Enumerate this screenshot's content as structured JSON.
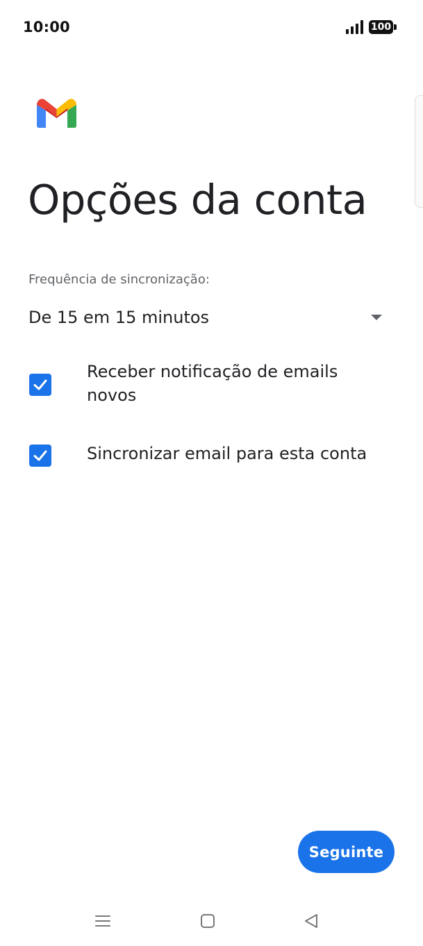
{
  "status_bar": {
    "time": "10:00",
    "signal_icon": "signal-strength-icon",
    "battery_level": "100",
    "battery_icon": "battery-icon"
  },
  "logo": {
    "icon": "gmail-logo"
  },
  "page": {
    "title": "Opções da conta"
  },
  "sync": {
    "label": "Frequência de sincronização:",
    "value": "De 15 em 15 minutos",
    "dropdown_icon": "chevron-down-icon"
  },
  "options": [
    {
      "label": "Receber notificação de emails novos",
      "checked": true
    },
    {
      "label": "Sincronizar email para esta conta",
      "checked": true
    }
  ],
  "actions": {
    "next_label": "Seguinte"
  },
  "navigation": {
    "menu_icon": "menu-icon",
    "home_icon": "home-icon",
    "back_icon": "back-icon"
  },
  "colors": {
    "accent": "#1a73e8",
    "text": "#202124",
    "secondary_text": "#5f6368",
    "background": "#ffffff"
  }
}
